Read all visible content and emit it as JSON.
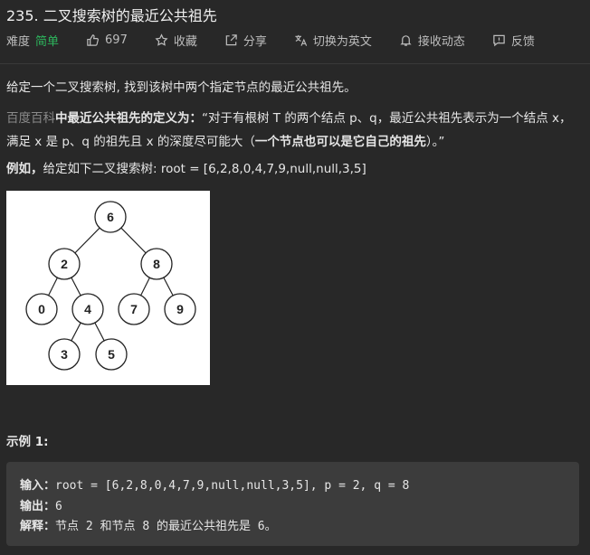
{
  "problem": {
    "title": "235. 二叉搜索树的最近公共祖先",
    "difficulty_label": "难度",
    "difficulty": "简单",
    "likes": "697",
    "favorite": "收藏",
    "share": "分享",
    "switch_lang": "切换为英文",
    "notify": "接收动态",
    "feedback": "反馈"
  },
  "description": {
    "p1": "给定一个二叉搜索树, 找到该树中两个指定节点的最近公共祖先。",
    "p2_link": "百度百科",
    "p2_bold": "中最近公共祖先的定义为：",
    "p2_text": "“对于有根树 T 的两个结点 p、q，最近公共祖先表示为一个结点 x，满足 x 是 p、q 的祖先且 x 的深度尽可能大（",
    "p2_strong": "一个节点也可以是它自己的祖先",
    "p2_end": "）。”",
    "p3_bold": "例如，",
    "p3_text": "给定如下二叉搜索树:  root = [6,2,8,0,4,7,9,null,null,3,5]"
  },
  "tree": {
    "nodes": [
      "6",
      "2",
      "8",
      "0",
      "4",
      "7",
      "9",
      "3",
      "5"
    ]
  },
  "example": {
    "title": "示例 1:",
    "input_label": "输入：",
    "input_value": "root = [6,2,8,0,4,7,9,null,null,3,5], p = 2, q = 8",
    "output_label": "输出：",
    "output_value": "6",
    "explain_label": "解释：",
    "explain_value": "节点 2 和节点 8 的最近公共祖先是 6。"
  },
  "colors": {
    "background": "#282828",
    "difficulty_easy": "#2db55d",
    "code_bg": "#3c3c3c",
    "link": "#8a8a8a"
  }
}
